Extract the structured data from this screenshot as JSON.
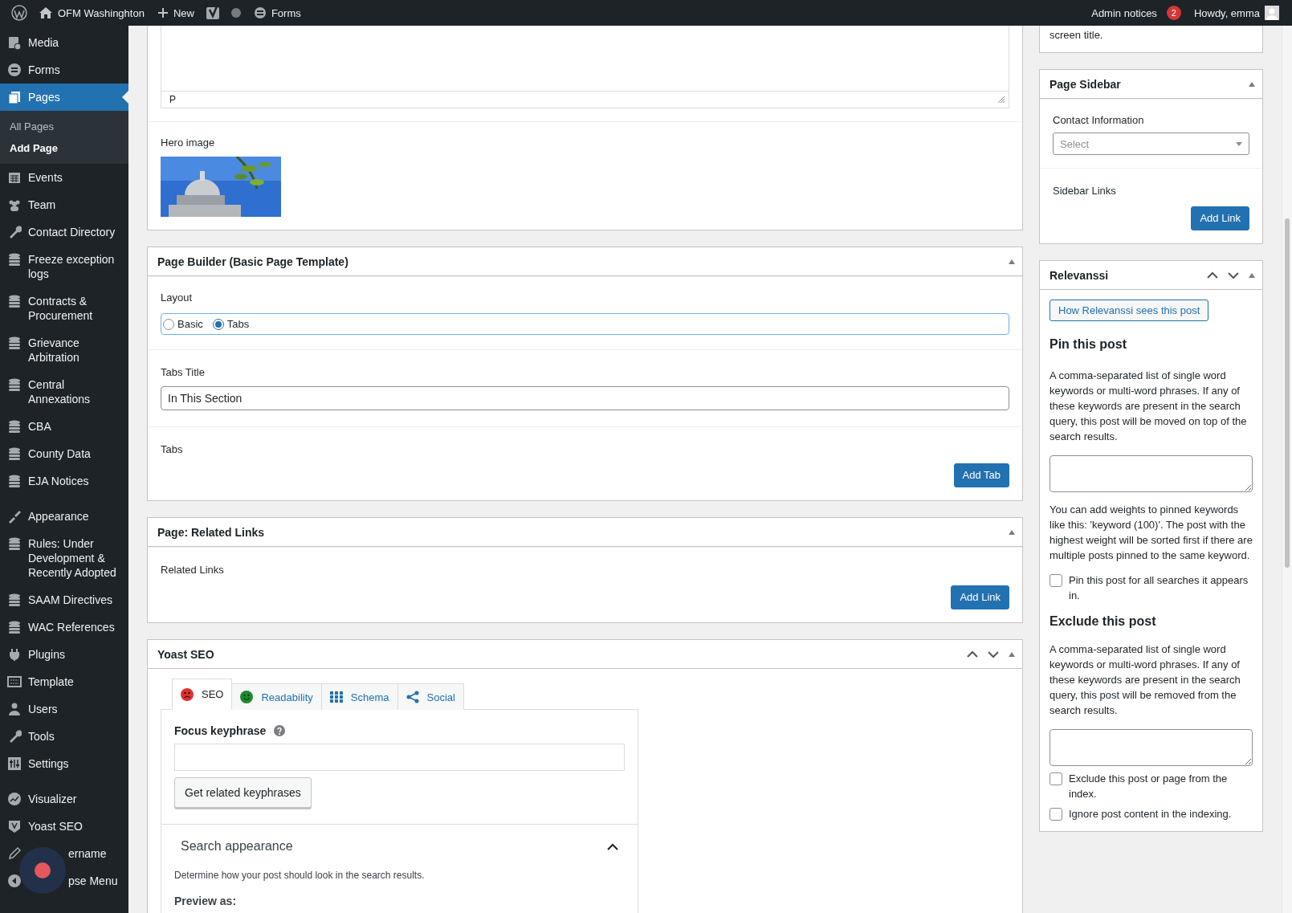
{
  "admin_bar": {
    "site": "OFM Washinghton",
    "new": "New",
    "forms": "Forms",
    "notices": "Admin notices",
    "notices_count": "2",
    "greeting": "Howdy, emma"
  },
  "sidebar": {
    "groups": [
      [
        {
          "label": "Media",
          "selected": false
        },
        {
          "label": "Forms",
          "selected": false
        },
        {
          "label": "Pages",
          "selected": true,
          "children": [
            {
              "label": "All Pages",
              "selected": false
            },
            {
              "label": "Add Page",
              "selected": true
            }
          ]
        },
        {
          "label": "Events",
          "selected": false
        },
        {
          "label": "Team",
          "selected": false
        },
        {
          "label": "Contact Directory",
          "selected": false
        },
        {
          "label": "Freeze exception logs",
          "selected": false
        },
        {
          "label": "Contracts & Procurement",
          "selected": false
        },
        {
          "label": "Grievance Arbitration",
          "selected": false
        },
        {
          "label": "Central Annexations",
          "selected": false
        },
        {
          "label": "CBA",
          "selected": false
        },
        {
          "label": "County Data",
          "selected": false
        },
        {
          "label": "EJA Notices",
          "selected": false
        }
      ],
      [
        {
          "label": "Appearance",
          "selected": false
        },
        {
          "label": "Rules: Under Development & Recently Adopted",
          "selected": false
        },
        {
          "label": "SAAM Directives",
          "selected": false
        },
        {
          "label": "WAC References",
          "selected": false
        },
        {
          "label": "Plugins",
          "selected": false
        },
        {
          "label": "Template",
          "selected": false
        },
        {
          "label": "Users",
          "selected": false
        },
        {
          "label": "Tools",
          "selected": false
        },
        {
          "label": "Settings",
          "selected": false
        }
      ],
      [
        {
          "label": "Visualizer",
          "selected": false
        },
        {
          "label": "Yoast SEO",
          "selected": false
        },
        {
          "label": "ername",
          "selected": false,
          "covered": true
        },
        {
          "label": "pse Menu",
          "selected": false,
          "covered": true
        }
      ]
    ]
  },
  "editor": {
    "status_path": "P",
    "hero_label": "Hero image"
  },
  "page_builder": {
    "title": "Page Builder (Basic Page Template)",
    "layout_label": "Layout",
    "layout_options": [
      {
        "label": "Basic",
        "selected": false
      },
      {
        "label": "Tabs",
        "selected": true
      }
    ],
    "tabs_title_label": "Tabs Title",
    "tabs_title_value": "In This Section",
    "tabs_label": "Tabs",
    "button": "Add Tab"
  },
  "related_links": {
    "title": "Page: Related Links",
    "label": "Related Links",
    "button": "Add Link"
  },
  "yoast": {
    "title": "Yoast SEO",
    "tabs": [
      {
        "label": "SEO",
        "selected": true,
        "color": "#dc3232"
      },
      {
        "label": "Readability",
        "selected": false,
        "color": "#1e8a2e"
      },
      {
        "label": "Schema",
        "selected": false
      },
      {
        "label": "Social",
        "selected": false
      }
    ],
    "focus_label": "Focus keyphrase",
    "related_button": "Get related keyphrases",
    "search_appearance": {
      "title": "Search appearance",
      "expanded": true,
      "description": "Determine how your post should look in the search results.",
      "preview_label": "Preview as:"
    }
  },
  "right": {
    "top_text": "screen title.",
    "page_sidebar": {
      "title": "Page Sidebar",
      "contact_label": "Contact Information",
      "select_placeholder": "Select",
      "links_label": "Sidebar Links",
      "button": "Add Link"
    },
    "relevanssi": {
      "title": "Relevanssi",
      "link_button": "How Relevanssi sees this post",
      "pin_heading": "Pin this post",
      "pin_description": "A comma-separated list of single word keywords or multi-word phrases. If any of these keywords are present in the search query, this post will be moved on top of the search results.",
      "pin_help": "You can add weights to pinned keywords like this: 'keyword (100)'. The post with the highest weight will be sorted first if there are multiple posts pinned to the same keyword.",
      "pin_checkboxes": [
        {
          "label": "Pin this post for all searches it appears in.",
          "checked": false
        }
      ],
      "exclude_heading": "Exclude this post",
      "exclude_description": "A comma-separated list of single word keywords or multi-word phrases. If any of these keywords are present in the search query, this post will be removed from the search results.",
      "exclude_checkboxes": [
        {
          "label": "Exclude this post or page from the index.",
          "checked": false
        },
        {
          "label": "Ignore post content in the indexing.",
          "checked": false
        }
      ]
    }
  }
}
